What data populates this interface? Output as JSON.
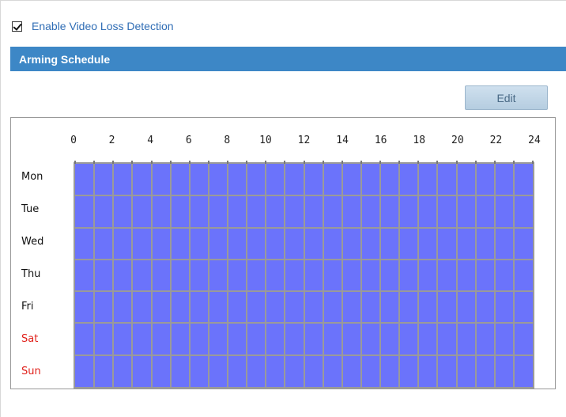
{
  "enable": {
    "label": "Enable Video Loss Detection",
    "checked": true
  },
  "section": {
    "title": "Arming Schedule"
  },
  "toolbar": {
    "edit_label": "Edit"
  },
  "schedule": {
    "hours": [
      "0",
      "2",
      "4",
      "6",
      "8",
      "10",
      "12",
      "14",
      "16",
      "18",
      "20",
      "22",
      "24"
    ],
    "days": [
      {
        "label": "Mon",
        "weekend": false
      },
      {
        "label": "Tue",
        "weekend": false
      },
      {
        "label": "Wed",
        "weekend": false
      },
      {
        "label": "Thu",
        "weekend": false
      },
      {
        "label": "Fri",
        "weekend": false
      },
      {
        "label": "Sat",
        "weekend": true
      },
      {
        "label": "Sun",
        "weekend": true
      }
    ],
    "armed_color": "#6b73fb",
    "weekend_label_color": "#e0201a",
    "armed_all_day": true
  }
}
